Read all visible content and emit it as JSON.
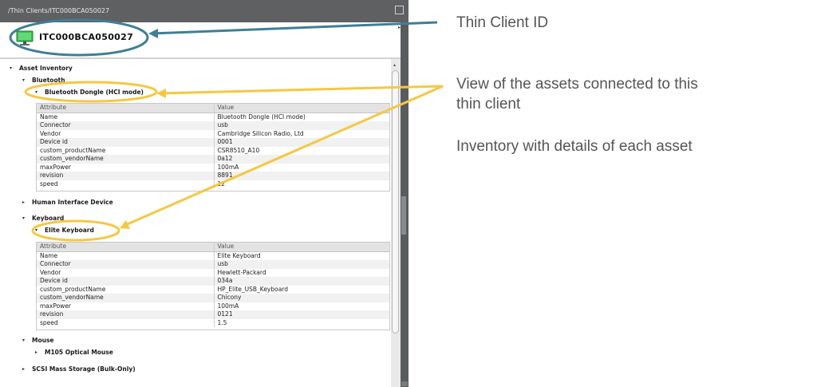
{
  "window": {
    "path": "/Thin Clients/ITC000BCA050027",
    "client_id": "ITC000BCA050027"
  },
  "tree": {
    "asset_inventory": "Asset Inventory",
    "bluetooth": "Bluetooth",
    "bluetooth_dongle": "Bluetooth Dongle (HCI mode)",
    "human_interface_device": "Human Interface Device",
    "keyboard": "Keyboard",
    "elite_keyboard": "Elite Keyboard",
    "mouse": "Mouse",
    "optical_mouse": "M105 Optical Mouse",
    "scsi": "SCSI Mass Storage (Bulk-Only)"
  },
  "tables": {
    "header": {
      "attribute": "Attribute",
      "value": "Value"
    },
    "bluetooth": [
      [
        "Name",
        "Bluetooth Dongle (HCI mode)"
      ],
      [
        "Connector",
        "usb"
      ],
      [
        "Vendor",
        "Cambridge Silicon Radio, Ltd"
      ],
      [
        "Device id",
        "0001"
      ],
      [
        "custom_productName",
        "CSR8510_A10"
      ],
      [
        "custom_vendorName",
        "0a12"
      ],
      [
        "maxPower",
        "100mA"
      ],
      [
        "revision",
        "8891"
      ],
      [
        "speed",
        "12"
      ]
    ],
    "keyboard": [
      [
        "Name",
        "Elite Keyboard"
      ],
      [
        "Connector",
        "usb"
      ],
      [
        "Vendor",
        "Hewlett-Packard"
      ],
      [
        "Device id",
        "034a"
      ],
      [
        "custom_productName",
        "HP_Elite_USB_Keyboard"
      ],
      [
        "custom_vendorName",
        "Chicony"
      ],
      [
        "maxPower",
        "100mA"
      ],
      [
        "revision",
        "0121"
      ],
      [
        "speed",
        "1.5"
      ]
    ]
  },
  "annotations": {
    "thin_client_id": "Thin Client ID",
    "view_line1": "View of the assets connected to this",
    "view_line2": "thin client",
    "inventory": "Inventory with details of each asset"
  },
  "colors": {
    "callout_blue": "#3f7f95",
    "callout_yellow": "#f5c842",
    "titlebar": "#5f6062",
    "monitor": "#3bbf4f"
  }
}
